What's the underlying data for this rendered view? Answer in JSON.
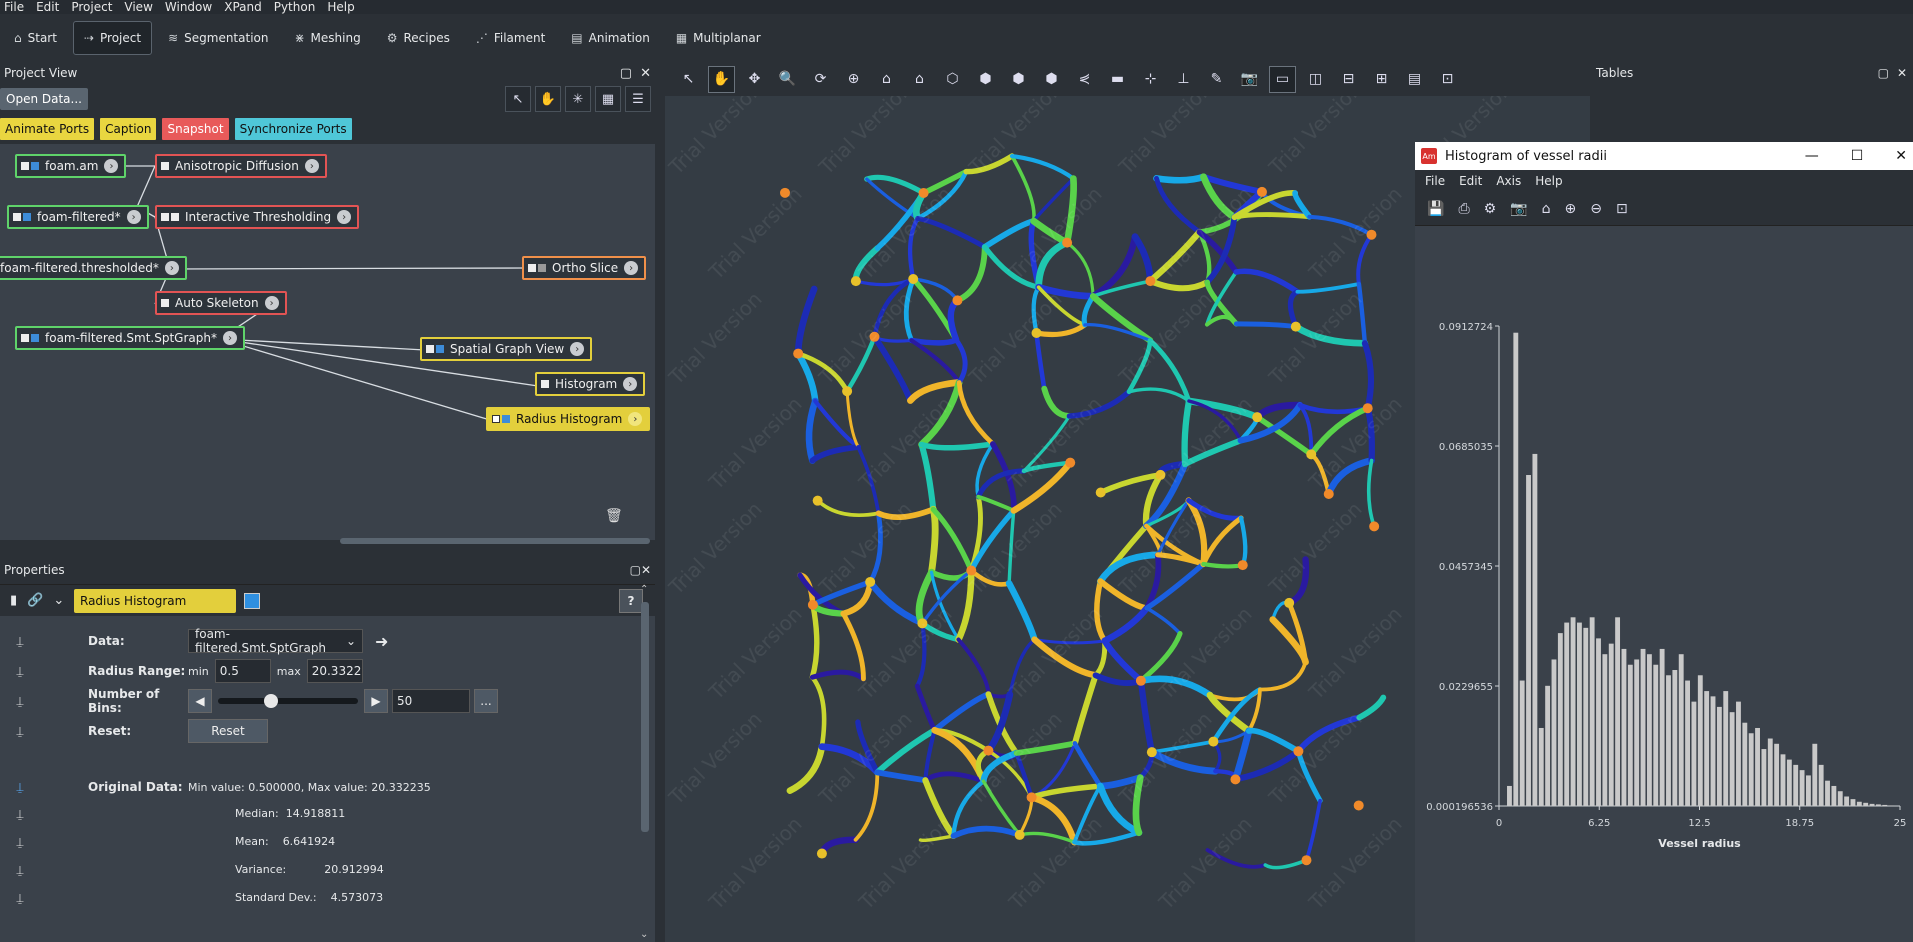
{
  "menubar": [
    "File",
    "Edit",
    "Project",
    "View",
    "Window",
    "XPand",
    "Python",
    "Help"
  ],
  "workrooms": [
    {
      "label": "Start",
      "icon": "home-icon",
      "glyph": "⌂",
      "active": false
    },
    {
      "label": "Project",
      "icon": "project-icon",
      "glyph": "⇢",
      "active": true
    },
    {
      "label": "Segmentation",
      "icon": "layers-icon",
      "glyph": "≋",
      "active": false
    },
    {
      "label": "Meshing",
      "icon": "mesh-icon",
      "glyph": "⋇",
      "active": false
    },
    {
      "label": "Recipes",
      "icon": "gears-icon",
      "glyph": "⚙",
      "active": false
    },
    {
      "label": "Filament",
      "icon": "filament-icon",
      "glyph": "⋰",
      "active": false
    },
    {
      "label": "Animation",
      "icon": "film-icon",
      "glyph": "▤",
      "active": false
    },
    {
      "label": "Multiplanar",
      "icon": "multiplanar-icon",
      "glyph": "▦",
      "active": false
    }
  ],
  "project_view": {
    "title": "Project View",
    "open_data": "Open Data...",
    "port_buttons": [
      {
        "label": "Animate Ports",
        "color": "yellow"
      },
      {
        "label": "Caption",
        "color": "yellow"
      },
      {
        "label": "Snapshot",
        "color": "red"
      },
      {
        "label": "Synchronize Ports",
        "color": "cyan"
      }
    ],
    "nodes": {
      "foam_am": "foam.am",
      "aniso": "Anisotropic Diffusion",
      "foam_filtered": "foam-filtered*",
      "interactive": "Interactive Thresholding",
      "thresholded": "foam-filtered.thresholded*",
      "ortho": "Ortho Slice",
      "auto_skel": "Auto Skeleton",
      "sptgraph": "foam-filtered.Smt.SptGraph*",
      "spatial_view": "Spatial Graph View",
      "histogram": "Histogram",
      "radius_hist": "Radius Histogram"
    }
  },
  "properties": {
    "title": "Properties",
    "module_name": "Radius Histogram",
    "help": "?",
    "data_label": "Data:",
    "data_value": "foam-filtered.Smt.SptGraph",
    "radius_label": "Radius Range:",
    "min_label": "min",
    "min_value": "0.5",
    "max_label": "max",
    "max_value": "20.3322",
    "bins_label": "Number of Bins:",
    "bins_value": "50",
    "bins_more": "...",
    "reset_label": "Reset:",
    "reset_button": "Reset",
    "orig_label": "Original Data:",
    "minmax": "Min value: 0.500000, Max value: 20.332235",
    "median_label": "Median:",
    "median_value": "14.918811",
    "mean_label": "Mean:",
    "mean_value": "6.641924",
    "variance_label": "Variance:",
    "variance_value": "20.912994",
    "std_label": "Standard Dev.:",
    "std_value": "4.573073"
  },
  "viewer": {
    "watermark": "Trial Version"
  },
  "tables": {
    "title": "Tables"
  },
  "histwin": {
    "title": "Histogram of vessel radii",
    "app_icon": "Am",
    "menu": [
      "File",
      "Edit",
      "Axis",
      "Help"
    ]
  },
  "chart_data": {
    "type": "bar",
    "title": "",
    "xlabel": "Vessel radius",
    "ylabel": "",
    "xlim": [
      0,
      25
    ],
    "ylim": [
      0.000196536,
      0.0912724
    ],
    "xticks": [
      "0",
      "6.25",
      "12.5",
      "18.75",
      "25"
    ],
    "yticks": [
      "0.0912724",
      "0.0685035",
      "0.0457345",
      "0.0229655",
      "0.000196536"
    ],
    "bin_width": 0.3966,
    "x_start": 0.5,
    "values": [
      0.004,
      0.09,
      0.024,
      0.063,
      0.067,
      0.015,
      0.023,
      0.028,
      0.033,
      0.035,
      0.036,
      0.035,
      0.034,
      0.036,
      0.032,
      0.029,
      0.031,
      0.036,
      0.03,
      0.027,
      0.028,
      0.03,
      0.029,
      0.027,
      0.03,
      0.025,
      0.026,
      0.029,
      0.024,
      0.02,
      0.025,
      0.022,
      0.021,
      0.019,
      0.022,
      0.018,
      0.02,
      0.016,
      0.014,
      0.015,
      0.011,
      0.013,
      0.012,
      0.01,
      0.009,
      0.008,
      0.007,
      0.006,
      0.012,
      0.008,
      0.005,
      0.004,
      0.003,
      0.002,
      0.0015,
      0.001,
      0.0008,
      0.0006,
      0.0005,
      0.0004,
      0.0003,
      0.0003,
      0.0002,
      0.0002,
      0.0001
    ],
    "bar_color": "#c9c9c9"
  }
}
